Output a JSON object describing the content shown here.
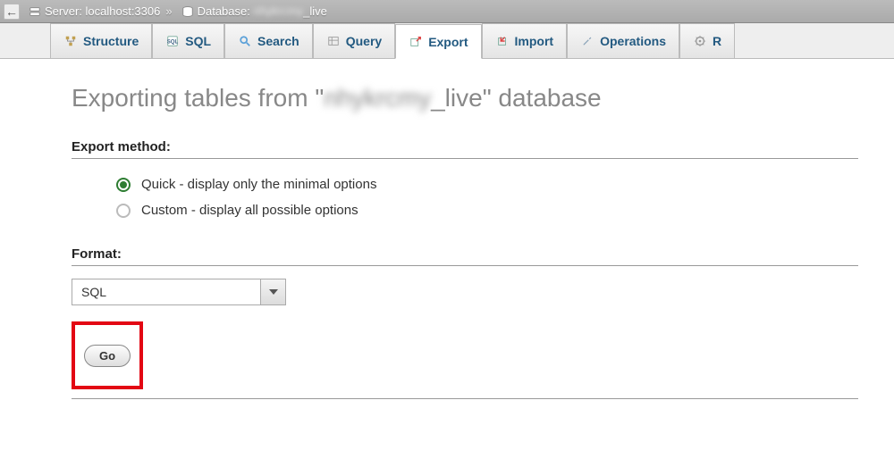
{
  "breadcrumb": {
    "server_label": "Server: localhost:3306",
    "database_label_prefix": "Database: ",
    "database_name_obscured": "nhykrcmy",
    "database_name_suffix": "_live"
  },
  "tabs": [
    {
      "id": "structure",
      "label": "Structure",
      "icon": "structure-icon"
    },
    {
      "id": "sql",
      "label": "SQL",
      "icon": "sql-icon"
    },
    {
      "id": "search",
      "label": "Search",
      "icon": "search-icon"
    },
    {
      "id": "query",
      "label": "Query",
      "icon": "query-icon"
    },
    {
      "id": "export",
      "label": "Export",
      "icon": "export-icon",
      "active": true
    },
    {
      "id": "import",
      "label": "Import",
      "icon": "import-icon"
    },
    {
      "id": "operations",
      "label": "Operations",
      "icon": "operations-icon"
    },
    {
      "id": "routines",
      "label": "R",
      "icon": "routines-icon"
    }
  ],
  "page": {
    "title_prefix": "Exporting tables from \"",
    "title_db_obscured": "nhykrcmy",
    "title_db_suffix": "_live",
    "title_suffix": "\" database"
  },
  "export_method": {
    "section_label": "Export method:",
    "options": [
      {
        "id": "quick",
        "label": "Quick - display only the minimal options",
        "selected": true
      },
      {
        "id": "custom",
        "label": "Custom - display all possible options",
        "selected": false
      }
    ]
  },
  "format": {
    "section_label": "Format:",
    "selected": "SQL"
  },
  "actions": {
    "go_label": "Go"
  },
  "highlight": {
    "target": "go-button",
    "color": "#e30613"
  }
}
